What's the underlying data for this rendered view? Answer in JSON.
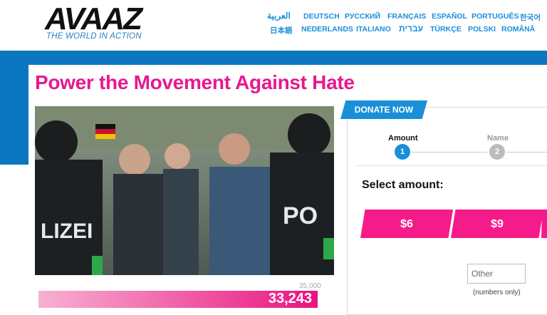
{
  "brand": {
    "name": "AVAAZ",
    "tagline": "THE WORLD IN ACTION"
  },
  "languages": [
    {
      "label": "العربية",
      "row": 1
    },
    {
      "label": "DEUTSCH",
      "row": 1
    },
    {
      "label": "РУССКИЙ",
      "row": 1
    },
    {
      "label": "FRANÇAIS",
      "row": 1
    },
    {
      "label": "ESPAÑOL",
      "row": 1
    },
    {
      "label": "PORTUGUÊS",
      "row": 1
    },
    {
      "label": "한국어",
      "row": 1
    },
    {
      "label": "日本語",
      "row": 2
    },
    {
      "label": "NEDERLANDS",
      "row": 2
    },
    {
      "label": "ITALIANO",
      "row": 2
    },
    {
      "label": "עברית",
      "row": 2
    },
    {
      "label": "TÜRKÇE",
      "row": 2
    },
    {
      "label": "POLSKI",
      "row": 2
    },
    {
      "label": "ROMÂNĂ",
      "row": 2
    }
  ],
  "page": {
    "title": "Power the Movement Against Hate"
  },
  "progress": {
    "current": "33,243",
    "goal": "35,000",
    "fraction": 0.95
  },
  "donate": {
    "tab_label": "DONATE NOW",
    "steps": [
      {
        "label": "Amount",
        "number": "1"
      },
      {
        "label": "Name",
        "number": "2"
      }
    ],
    "select_label": "Select amount:",
    "amounts": [
      "$6",
      "$9"
    ],
    "other_placeholder": "Other",
    "other_hint": "(numbers only)"
  },
  "colors": {
    "accent_pink": "#e6198f",
    "brand_blue": "#0b77c0",
    "link_blue": "#1a8fd8"
  }
}
